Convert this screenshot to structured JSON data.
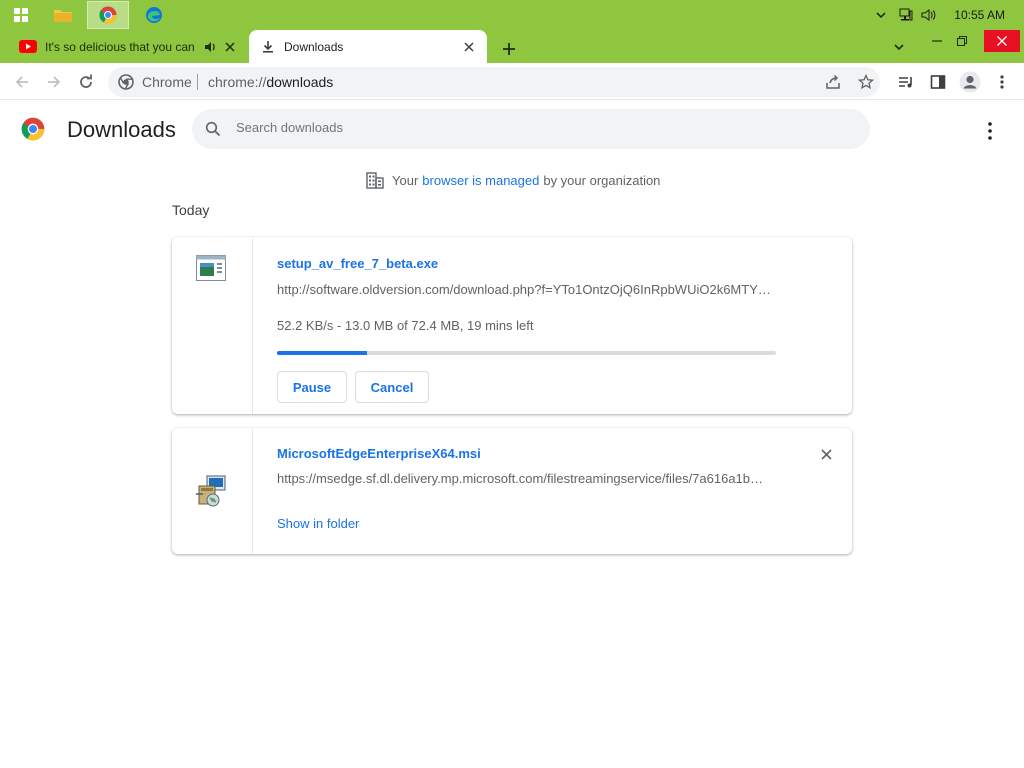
{
  "taskbar": {
    "clock": "10:55 AM",
    "colors": {
      "bar": "#8ec63f"
    }
  },
  "tabs": [
    {
      "title": "It's so delicious that you can",
      "icon": "youtube-icon",
      "audio": true
    },
    {
      "title": "Downloads",
      "icon": "download-icon",
      "active": true
    }
  ],
  "toolbar": {
    "site_chip": "Chrome",
    "url_scheme": "chrome://",
    "url_path": "downloads"
  },
  "downloads_page": {
    "title": "Downloads",
    "search_placeholder": "Search downloads",
    "managed_prefix": "Your",
    "managed_link": "browser is managed",
    "managed_suffix": "by your organization",
    "section_label": "Today",
    "items": [
      {
        "name": "setup_av_free_7_beta.exe",
        "url": "http://software.oldversion.com/download.php?f=YTo1OntzOjQ6InRpbWUiO2k6MTY2…",
        "status": "52.2 KB/s - 13.0 MB of 72.4 MB, 19 mins left",
        "progress": 0.18,
        "pause_label": "Pause",
        "cancel_label": "Cancel"
      },
      {
        "name": "MicrosoftEdgeEnterpriseX64.msi",
        "url": "https://msedge.sf.dl.delivery.mp.microsoft.com/filestreamingservice/files/7a616a1b…",
        "show_folder_label": "Show in folder"
      }
    ]
  },
  "colors": {
    "accent": "#1a73e8",
    "muted": "#5f6368"
  }
}
